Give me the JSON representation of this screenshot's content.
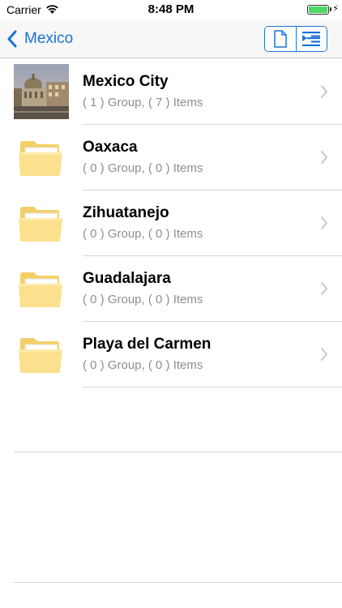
{
  "status_bar": {
    "carrier": "Carrier",
    "time": "8:48 PM",
    "battery_level": 1.0
  },
  "nav": {
    "back_label": "Mexico",
    "accent_color": "#1a73d9",
    "segments": [
      "document-icon",
      "outline-list-icon"
    ]
  },
  "items": [
    {
      "title": "Mexico City",
      "subtitle": "( 1 ) Group, ( 7 ) Items",
      "icon": "photo-thumbnail"
    },
    {
      "title": "Oaxaca",
      "subtitle": "( 0 ) Group, ( 0 ) Items",
      "icon": "folder-icon"
    },
    {
      "title": "Zihuatanejo",
      "subtitle": "( 0 ) Group, ( 0 ) Items",
      "icon": "folder-icon"
    },
    {
      "title": "Guadalajara",
      "subtitle": "( 0 ) Group, ( 0 ) Items",
      "icon": "folder-icon"
    },
    {
      "title": "Playa del Carmen",
      "subtitle": "( 0 ) Group, ( 0 ) Items",
      "icon": "folder-icon"
    }
  ]
}
